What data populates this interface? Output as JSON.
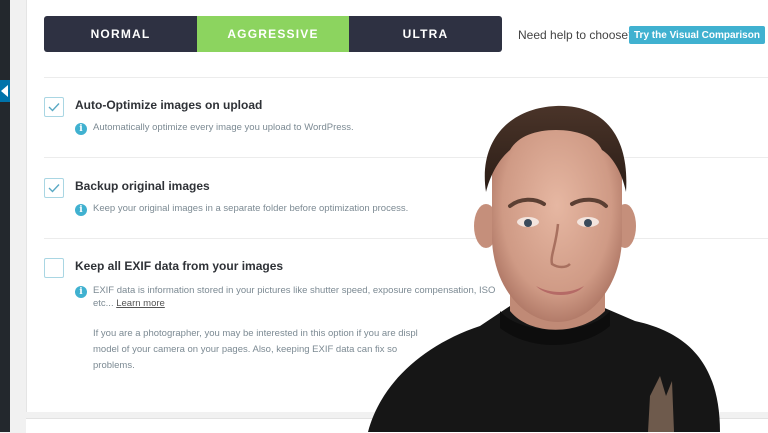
{
  "level_tabs": [
    {
      "label": "NORMAL",
      "active": false
    },
    {
      "label": "AGGRESSIVE",
      "active": true
    },
    {
      "label": "ULTRA",
      "active": false
    }
  ],
  "help": {
    "text": "Need help to choose?",
    "compare_button": "Try the Visual Comparison"
  },
  "options": [
    {
      "title": "Auto-Optimize images on upload",
      "checked": true,
      "description": "Automatically optimize every image you upload to WordPress."
    },
    {
      "title": "Backup original images",
      "checked": true,
      "description": "Keep your original images in a separate folder before optimization process."
    },
    {
      "title": "Keep all EXIF data from your images",
      "checked": false,
      "description_line1": "EXIF data is information stored in your pictures like shutter speed, exposure compensation, ISO",
      "description_line2": "etc... ",
      "learn_more": "Learn more",
      "photographer_note": [
        "If you are a photographer, you may be interested in this option if you are displ",
        "model of your camera on your pages. Also, keeping EXIF data can fix so",
        "problems."
      ]
    }
  ],
  "colors": {
    "tab_bar": "#2e3142",
    "tab_active": "#8cd45f",
    "accent": "#40b1d0",
    "admin_bar": "#23282d"
  },
  "icons": {
    "checkbox_checked": "check-icon",
    "info": "info-icon",
    "sidebar_toggle": "triangle-left-icon"
  }
}
